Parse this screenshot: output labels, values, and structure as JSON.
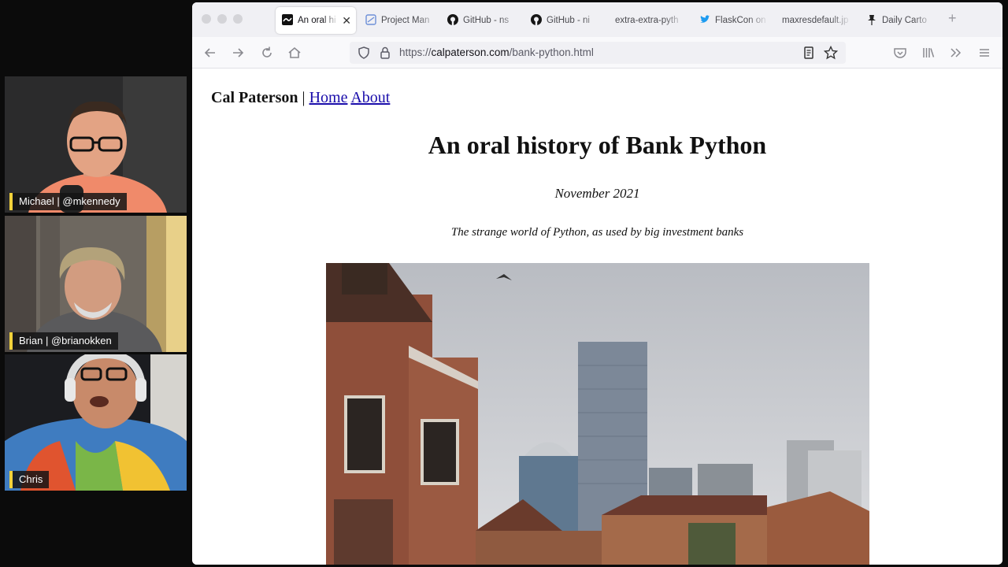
{
  "participants": [
    {
      "label": "Michael | @mkennedy"
    },
    {
      "label": "Brian | @brianokken"
    },
    {
      "label": "Chris"
    }
  ],
  "browser": {
    "tabs": [
      {
        "label": "An oral hi",
        "icon": "calpaterson-logo-icon",
        "active": true
      },
      {
        "label": "Project Man",
        "icon": "project-icon",
        "active": false
      },
      {
        "label": "GitHub - ns",
        "icon": "github-icon",
        "active": false
      },
      {
        "label": "GitHub - ni",
        "icon": "github-icon",
        "active": false
      },
      {
        "label": "extra-extra-pyth",
        "icon": "none",
        "active": false
      },
      {
        "label": "FlaskCon on",
        "icon": "twitter-icon",
        "active": false
      },
      {
        "label": "maxresdefault.jp",
        "icon": "none",
        "active": false
      },
      {
        "label": "Daily Carto",
        "icon": "pin-icon",
        "active": false
      }
    ],
    "url_prefix": "https://",
    "url_host": "calpaterson.com",
    "url_path": "/bank-python.html"
  },
  "page": {
    "site_name": "Cal Paterson",
    "separator": " | ",
    "nav": [
      "Home",
      "About"
    ],
    "title": "An oral history of Bank Python",
    "date": "November 2021",
    "subtitle": "The strange world of Python, as used by big investment banks"
  },
  "colors": {
    "name_tag_accent": "#f2d23a",
    "link": "#1a0dab",
    "tabbar": "#f0f0f4"
  }
}
